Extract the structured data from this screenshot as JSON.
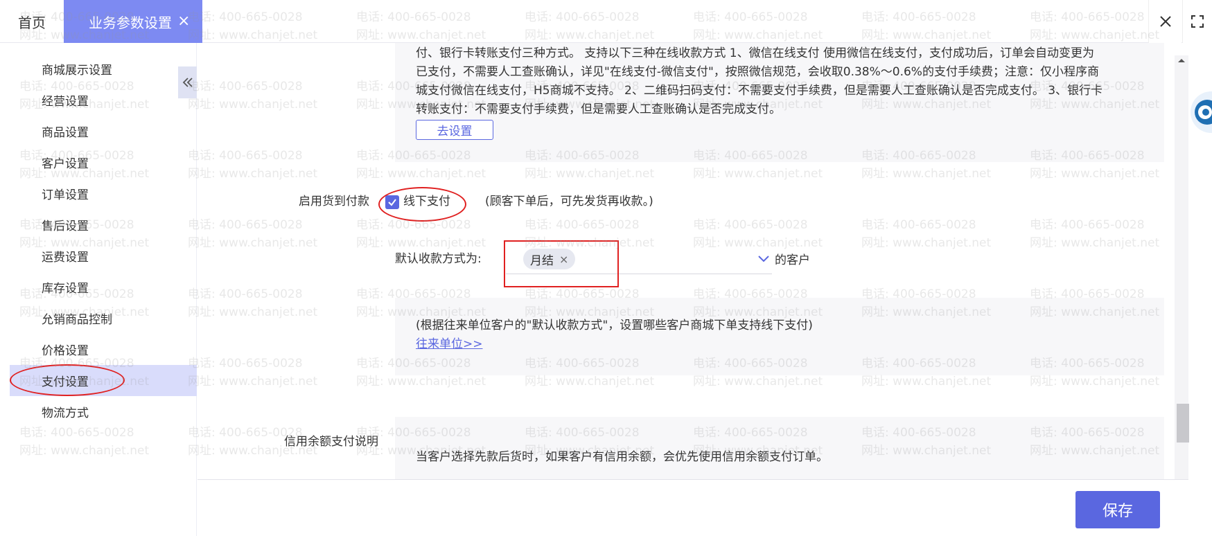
{
  "tabs": {
    "home": "首页",
    "active": "业务参数设置",
    "active_close": "×"
  },
  "sidebar": {
    "items": [
      {
        "label": "商城展示设置"
      },
      {
        "label": "经营设置"
      },
      {
        "label": "商品设置"
      },
      {
        "label": "客户设置"
      },
      {
        "label": "订单设置"
      },
      {
        "label": "售后设置"
      },
      {
        "label": "运费设置"
      },
      {
        "label": "库存设置"
      },
      {
        "label": "允销商品控制"
      },
      {
        "label": "价格设置"
      },
      {
        "label": "支付设置"
      },
      {
        "label": "物流方式"
      }
    ],
    "active_index": 10
  },
  "online_payment": {
    "desc_line1": "付、银行卡转账支付三种方式。 支持以下三种在线收款方式 1、微信在线支付 使用微信在线支付，支付成功后，订单会自动变更为",
    "desc_line2": "已支付，不需要人工查账确认，详见\"在线支付-微信支付\"，按照微信规范，会收取0.38%～0.6%的支付手续费；注意：仅小程序商",
    "desc_line3": "城支付微信在线支付，H5商城不支持。 2、二维码扫码支付：不需要支付手续费，但是需要人工查账确认是否完成支付。 3、银行卡",
    "desc_line4": "转账支付：不需要支付手续费，但是需要人工查账确认是否完成支付。",
    "goto_settings": "去设置"
  },
  "cod": {
    "label": "启用货到付款",
    "checkbox_label": "线下支付",
    "hint": "(顾客下单后，可先发货再收款。)",
    "default_label": "默认收款方式为:",
    "selected_tag": "月结",
    "tag_remove": "×",
    "suffix": "的客户",
    "note": "(根据往来单位客户的\"默认收款方式\"，设置哪些客户商城下单支持线下支付)",
    "link": "往来单位>>"
  },
  "credit": {
    "label": "信用余额支付说明",
    "text": "当客户选择先款后货时，如果客户有信用余额，会优先使用信用余额支付订单。"
  },
  "footer": {
    "save": "保存"
  },
  "watermark": {
    "phone": "电话: 400-665-0028",
    "site": "网址: www.chanjet.net"
  },
  "colors": {
    "accent": "#5a67e0",
    "tab_active": "#7d8af2",
    "sidebar_active": "#d9dcfb",
    "annotation": "#e02020"
  }
}
